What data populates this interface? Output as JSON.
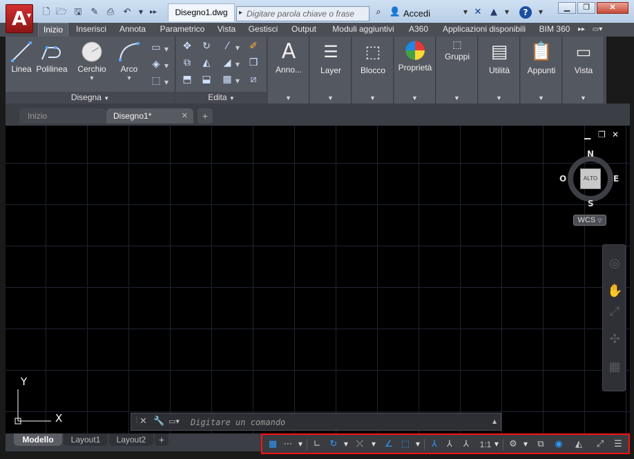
{
  "titlebar": {
    "app_menu_glyph": "A",
    "doc_tab": "Disegno1.dwg",
    "search_placeholder": "Digitare parola chiave o frase",
    "signin_label": "Accedi",
    "help_glyph": "?"
  },
  "ribbon_tabs": [
    {
      "label": "Inizio",
      "active": true
    },
    {
      "label": "Inserisci"
    },
    {
      "label": "Annota"
    },
    {
      "label": "Parametrico"
    },
    {
      "label": "Vista"
    },
    {
      "label": "Gestisci"
    },
    {
      "label": "Output"
    },
    {
      "label": "Moduli aggiuntivi"
    },
    {
      "label": "A360"
    },
    {
      "label": "Applicazioni disponibili"
    },
    {
      "label": "BIM 360"
    }
  ],
  "ribbon": {
    "draw_panel": {
      "title": "Disegna",
      "tools": [
        {
          "label": "Linea",
          "icon": "line-icon"
        },
        {
          "label": "Polilinea",
          "icon": "polyline-icon"
        },
        {
          "label": "Cerchio",
          "icon": "circle-icon"
        },
        {
          "label": "Arco",
          "icon": "arc-icon"
        }
      ]
    },
    "edit_panel": {
      "title": "Edita"
    },
    "big_panels": [
      {
        "label": "Anno...",
        "icon": "annotation-icon"
      },
      {
        "label": "Layer",
        "icon": "layer-icon"
      },
      {
        "label": "Blocco",
        "icon": "block-icon"
      },
      {
        "label": "Proprietà",
        "icon": "properties-icon"
      },
      {
        "label": "Gruppi",
        "icon": "groups-icon"
      },
      {
        "label": "Utilità",
        "icon": "utilities-icon"
      },
      {
        "label": "Appunti",
        "icon": "clipboard-icon"
      },
      {
        "label": "Vista",
        "icon": "view-icon"
      }
    ]
  },
  "file_tabs": {
    "start": "Inizio",
    "drawing": "Disegno1*"
  },
  "viewport": {
    "viewcube": {
      "top": "ALTO",
      "north": "N",
      "south": "S",
      "east": "E",
      "west": "O"
    },
    "wcs_label": "WCS",
    "ucs": {
      "x": "X",
      "y": "Y"
    },
    "command_placeholder": "Digitare un comando"
  },
  "layout_tabs": [
    {
      "label": "Modello",
      "active": true
    },
    {
      "label": "Layout1"
    },
    {
      "label": "Layout2"
    }
  ],
  "statusbar": {
    "scale": "1:1"
  },
  "colors": {
    "accent_blue": "#2b9bff",
    "highlight_red": "#ff1010",
    "app_red": "#c41e1e"
  }
}
